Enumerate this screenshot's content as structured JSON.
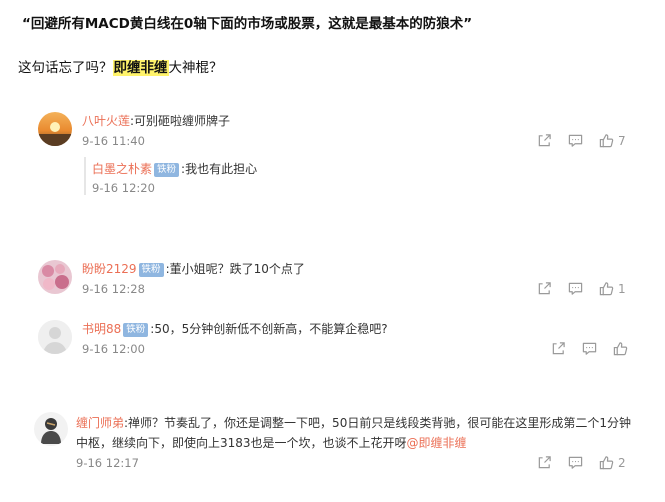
{
  "article": {
    "quote": "“回避所有MACD黄白线在0轴下面的市场或股票，这就是最基本的防狼术”",
    "para_prefix": "这句话忘了吗？",
    "para_highlight": "即缠非缠",
    "para_suffix": "大神棍？"
  },
  "comments": [
    {
      "user": "八叶火莲",
      "badge": "",
      "text": ":可别砸啦缠师牌子",
      "time": "9-16 11:40",
      "likes": "7",
      "reply": {
        "user": "白墨之朴素",
        "badge": "铁粉",
        "text": ":我也有此担心",
        "time": "9-16 12:20"
      }
    },
    {
      "user": "盼盼2129",
      "badge": "铁粉",
      "text": ":董小姐呢？跌了10个点了",
      "time": "9-16 12:28",
      "likes": "1"
    },
    {
      "user": "书明88",
      "badge": "铁粉",
      "text": ":50，5分钟创新低不创新高，不能算企稳吧?",
      "time": "9-16 12:00",
      "likes": ""
    },
    {
      "user": "缠门师弟",
      "badge": "",
      "text_line1": ":禅师？节奏乱了，你还是调整一下吧，50日前只是线段类背驰，很可能在这里形成第二个1分钟",
      "text_line2": "中枢，继续向下，即使向上3183也是一个坎，也谈不上花开呀",
      "mention": "@即缠非缠",
      "time": "9-16 12:17",
      "likes": "2"
    }
  ],
  "icons": {
    "share": "share-icon",
    "comment": "comment-icon",
    "like": "thumbs-up-icon"
  },
  "colors": {
    "username": "#eb6f55",
    "badge": "#8fb6e0",
    "highlight": "#fff36b"
  }
}
